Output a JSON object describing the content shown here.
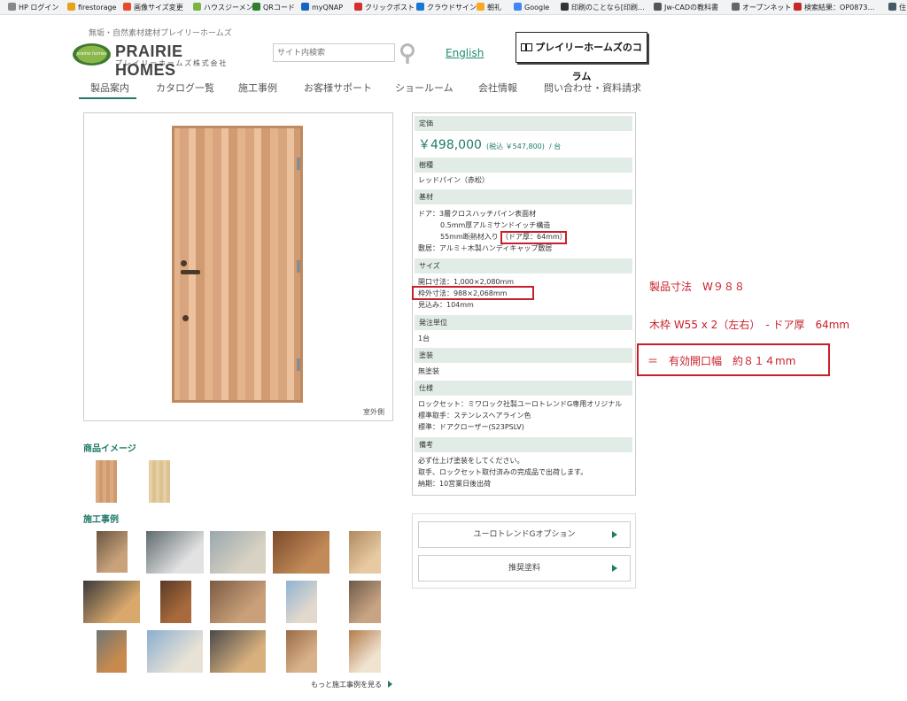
{
  "bookmarks": [
    {
      "label": "HP ログイン",
      "color": "#888888"
    },
    {
      "label": "firestorage",
      "color": "#e8a21a"
    },
    {
      "label": "画像サイズ変更",
      "color": "#e44b2c"
    },
    {
      "label": "ハウスジーメン",
      "color": "#7cb342"
    },
    {
      "label": "QRコード",
      "color": "#2e7d32"
    },
    {
      "label": "myQNAP",
      "color": "#1565c0"
    },
    {
      "label": "クリックポスト",
      "color": "#d32f2f"
    },
    {
      "label": "クラウドサイン",
      "color": "#1976d2"
    },
    {
      "label": "朝礼",
      "color": "#f9a825"
    },
    {
      "label": "Google",
      "color": "#4285f4"
    },
    {
      "label": "印刷のことなら[印刷…",
      "color": "#333333"
    },
    {
      "label": "Jw-CADの教科書",
      "color": "#555555"
    },
    {
      "label": "オープンネット",
      "color": "#666666"
    },
    {
      "label": "検索結果：OP0873…",
      "color": "#c62828"
    },
    {
      "label": "住",
      "color": "#455a64"
    }
  ],
  "header": {
    "tagline": "無垢・自然素材建材プレイリーホームズ",
    "logo_main": "PRAIRIE HOMES",
    "logo_sub": "プレイリーホームズ株式会社",
    "logo_mark": "prairie homes",
    "search_placeholder": "サイト内検索",
    "english": "English",
    "column_button": "プレイリーホームズのコラム"
  },
  "nav": [
    "製品案内",
    "カタログ一覧",
    "施工事例",
    "お客様サポート",
    "ショールーム",
    "会社情報",
    "問い合わせ・資料請求"
  ],
  "product": {
    "image_caption": "室外側",
    "product_images_title": "商品イメージ",
    "case_studies_title": "施工事例",
    "more_cases": "もっと施工事例を見る"
  },
  "spec": {
    "price_label": "定価",
    "price": "￥498,000",
    "price_tax": "(税込 ￥547,800)",
    "price_unit": "/ 台",
    "species_label": "樹種",
    "species": "レッドパイン（赤松）",
    "base_label": "基材",
    "base_lines": [
      "ドア：3層クロスハッチパイン表面材",
      "0.5mm厚アルミサンドイッチ構造",
      "55mm断熱材入り",
      "（ドア厚：64mm）",
      "敷居：アルミ＋木製ハンディキャップ敷居"
    ],
    "size_label": "サイズ",
    "size_lines": [
      "開口寸法：1,000×2,080mm",
      "枠外寸法：988×2,068mm",
      "見込み：104mm"
    ],
    "order_label": "発注単位",
    "order": "1台",
    "paint_label": "塗装",
    "paint": "無塗装",
    "spec_label": "仕様",
    "spec_lines": [
      "ロックセット：ミワロック社製ユーロトレンドG専用オリジナル",
      "標準取手：ステンレスヘアライン色",
      "標準：ドアクローザー(S23PSLV)"
    ],
    "notes_label": "備考",
    "notes_lines": [
      "必ず仕上げ塗装をしてください。",
      "取手、ロックセット取付済みの完成品で出荷します。",
      "納期：10営業日後出荷"
    ]
  },
  "options": [
    "ユーロトレンドGオプション",
    "推奨塗料"
  ],
  "annotations": {
    "line1": "製品寸法　W９８８",
    "line2": "木枠 W55 x 2（左右）　- ドア厚　64mm",
    "line3": "＝　有効開口幅　約８１４mm"
  },
  "colors": {
    "accent": "#1f7a68",
    "annotation": "#c8202a"
  }
}
